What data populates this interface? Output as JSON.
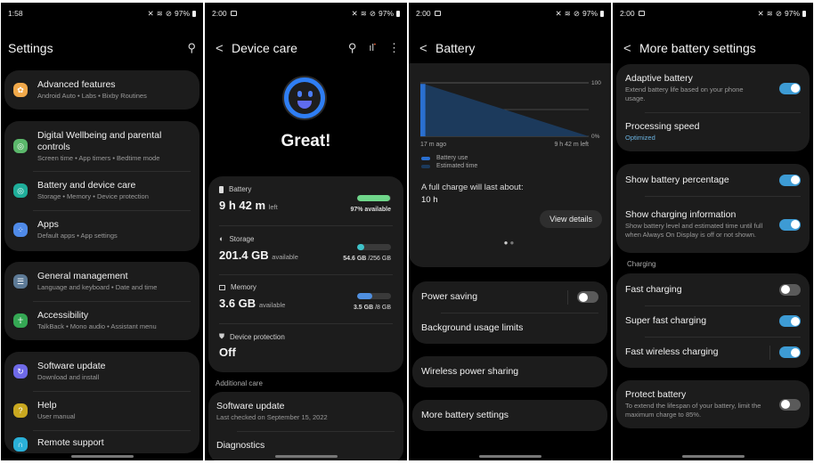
{
  "screens": {
    "settings": {
      "status": {
        "time": "1:58",
        "battery": "97%"
      },
      "title": "Settings",
      "search_icon": "search-icon",
      "groups": [
        {
          "items": [
            {
              "title": "Advanced features",
              "subtitle": "Android Auto  •  Labs  •  Bixby Routines",
              "icon": "gear-icon",
              "color": "#f1a94a"
            }
          ]
        },
        {
          "items": [
            {
              "title": "Digital Wellbeing and parental controls",
              "subtitle": "Screen time  •  App timers  •  Bedtime mode",
              "icon": "wellbeing-icon",
              "color": "#5bb86b"
            },
            {
              "title": "Battery and device care",
              "subtitle": "Storage  •  Memory  •  Device protection",
              "icon": "device-care-icon",
              "color": "#1fae9a"
            },
            {
              "title": "Apps",
              "subtitle": "Default apps  •  App settings",
              "icon": "apps-icon",
              "color": "#4f8ae8"
            }
          ]
        },
        {
          "items": [
            {
              "title": "General management",
              "subtitle": "Language and keyboard  •  Date and time",
              "icon": "sliders-icon",
              "color": "#5d7a96"
            },
            {
              "title": "Accessibility",
              "subtitle": "TalkBack  •  Mono audio  •  Assistant menu",
              "icon": "accessibility-icon",
              "color": "#35a854"
            }
          ]
        },
        {
          "items": [
            {
              "title": "Software update",
              "subtitle": "Download and install",
              "icon": "software-update-icon",
              "color": "#6f6ae8"
            },
            {
              "title": "Help",
              "subtitle": "User manual",
              "icon": "help-icon",
              "color": "#c9a820"
            },
            {
              "title": "Remote support",
              "subtitle": "",
              "icon": "headset-icon",
              "color": "#2ab0d8"
            }
          ]
        }
      ]
    },
    "device_care": {
      "status": {
        "time": "2:00",
        "battery": "97%"
      },
      "title": "Device care",
      "status_text": "Great!",
      "battery": {
        "label": "Battery",
        "value": "9 h 42 m",
        "unit": "left",
        "meter_text": "97% available",
        "fraction": 0.97,
        "color": "#6fd68a"
      },
      "storage": {
        "label": "Storage",
        "value": "201.4 GB",
        "unit": "available",
        "used": "54.6 GB",
        "total": "/256 GB",
        "fraction": 0.21,
        "color": "#3ec2c9"
      },
      "memory": {
        "label": "Memory",
        "value": "3.6 GB",
        "unit": "available",
        "used": "3.5 GB",
        "total": "/8 GB",
        "fraction": 0.44,
        "color": "#4f8fe0"
      },
      "protection": {
        "label": "Device protection",
        "value": "Off"
      },
      "additional_label": "Additional care",
      "software_update": {
        "title": "Software update",
        "subtitle": "Last checked on September 15, 2022"
      },
      "diagnostics": "Diagnostics"
    },
    "battery": {
      "status": {
        "time": "2:00",
        "battery": "97%"
      },
      "title": "Battery",
      "chart_data": {
        "type": "area",
        "y_ticks": [
          "100",
          "0%"
        ],
        "x_labels": [
          "17 m ago",
          "9 h 42 m left"
        ],
        "ylim": [
          0,
          100
        ],
        "series": [
          {
            "name": "Battery use",
            "color": "#2a6fd0",
            "x": [
              0,
              0.03
            ],
            "values": [
              98,
              97
            ]
          },
          {
            "name": "Estimated time",
            "color": "#1c3a5c",
            "x": [
              0.03,
              1
            ],
            "values": [
              97,
              0
            ]
          }
        ],
        "legend_position": "bottom-left"
      },
      "full_charge_label": "A full charge will last about:",
      "full_charge_value": "10 h",
      "view_details": "View details",
      "items": [
        {
          "title": "Power saving",
          "toggle": false
        },
        {
          "title": "Background usage limits"
        },
        {
          "title": "Wireless power sharing"
        },
        {
          "title": "More battery settings"
        }
      ]
    },
    "more_battery": {
      "status": {
        "time": "2:00",
        "battery": "97%"
      },
      "title": "More battery settings",
      "adaptive": {
        "title": "Adaptive battery",
        "subtitle": "Extend battery life based on your phone usage.",
        "on": true
      },
      "processing": {
        "title": "Processing speed",
        "value": "Optimized",
        "value_color": "#6bb3e0"
      },
      "show_pct": {
        "title": "Show battery percentage",
        "on": true
      },
      "show_charging": {
        "title": "Show charging information",
        "subtitle": "Show battery level and estimated time until full when Always On Display is off or not shown.",
        "on": true
      },
      "charging_label": "Charging",
      "fast": {
        "title": "Fast charging",
        "on": false
      },
      "super_fast": {
        "title": "Super fast charging",
        "on": true
      },
      "fast_wireless": {
        "title": "Fast wireless charging",
        "on": true
      },
      "protect": {
        "title": "Protect battery",
        "subtitle": "To extend the lifespan of your battery, limit the maximum charge to 85%.",
        "on": false
      }
    }
  }
}
